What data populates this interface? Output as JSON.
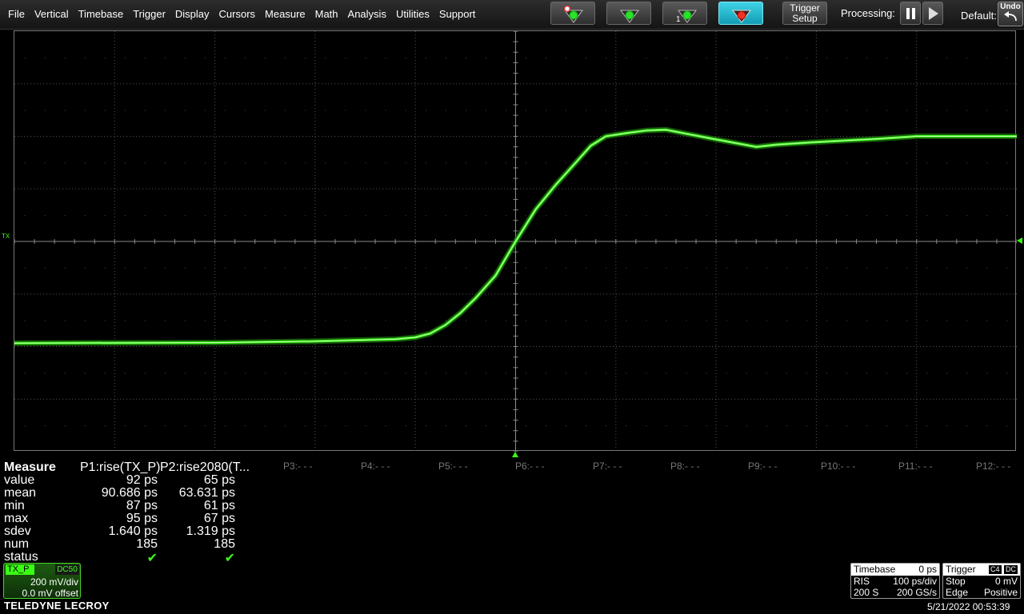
{
  "menu": {
    "items": [
      "File",
      "Vertical",
      "Timebase",
      "Trigger",
      "Display",
      "Cursors",
      "Measure",
      "Math",
      "Analysis",
      "Utilities",
      "Support"
    ]
  },
  "toolbar": {
    "trigger_setup_line1": "Trigger",
    "trigger_setup_line2": "Setup",
    "processing_label": "Processing:",
    "default_label": "Default:",
    "undo_label": "Undo",
    "single_label": "1"
  },
  "channel_marker": "TX",
  "measure": {
    "title": "Measure",
    "p1_header": "P1:rise(TX_P)",
    "p2_header": "P2:rise2080(T...",
    "rows": [
      {
        "label": "value",
        "p1": "92 ps",
        "p2": "65 ps"
      },
      {
        "label": "mean",
        "p1": "90.686 ps",
        "p2": "63.631 ps"
      },
      {
        "label": "min",
        "p1": "87 ps",
        "p2": "61 ps"
      },
      {
        "label": "max",
        "p1": "95 ps",
        "p2": "67 ps"
      },
      {
        "label": "sdev",
        "p1": "1.640 ps",
        "p2": "1.319 ps"
      },
      {
        "label": "num",
        "p1": "185",
        "p2": "185"
      },
      {
        "label": "status",
        "p1": "✔",
        "p2": "✔"
      }
    ],
    "empty_params": [
      "P3:- - -",
      "P4:- - -",
      "P5:- - -",
      "P6:- - -",
      "P7:- - -",
      "P8:- - -",
      "P9:- - -",
      "P10:- - -",
      "P11:- - -",
      "P12:- - -"
    ]
  },
  "channel": {
    "name": "TX_P",
    "coupling": "DC50",
    "vdiv": "200 mV/div",
    "offset": "0.0 mV offset",
    "color": "#39ff14"
  },
  "brand": "TELEDYNE LECROY",
  "timebase": {
    "label": "Timebase",
    "delay": "0 ps",
    "mode": "RIS",
    "tdiv": "100 ps/div",
    "memory": "200 S",
    "rate": "200 GS/s"
  },
  "trigger": {
    "label": "Trigger",
    "source": "C4",
    "coupling": "DC",
    "mode": "Stop",
    "level": "0 mV",
    "type": "Edge",
    "slope": "Positive"
  },
  "datetime": "5/21/2022 00:53:39",
  "chart_data": {
    "type": "line",
    "x_divisions": 10,
    "y_divisions": 8,
    "xlim": [
      -500,
      500
    ],
    "ylim": [
      -800,
      800
    ],
    "series": [
      {
        "name": "TX_P",
        "x": [
          -500,
          -300,
          -200,
          -120,
          -100,
          -85,
          -70,
          -55,
          -40,
          -20,
          0,
          20,
          40,
          60,
          75,
          90,
          110,
          130,
          150,
          170,
          200,
          240,
          260,
          300,
          320,
          360,
          400,
          440,
          480,
          500
        ],
        "y": [
          -387,
          -385,
          -380,
          -372,
          -365,
          -350,
          -318,
          -272,
          -216,
          -130,
          0,
          122,
          215,
          300,
          364,
          400,
          412,
          422,
          425,
          410,
          388,
          360,
          368,
          378,
          382,
          390,
          400,
          400,
          400,
          400
        ]
      }
    ]
  }
}
